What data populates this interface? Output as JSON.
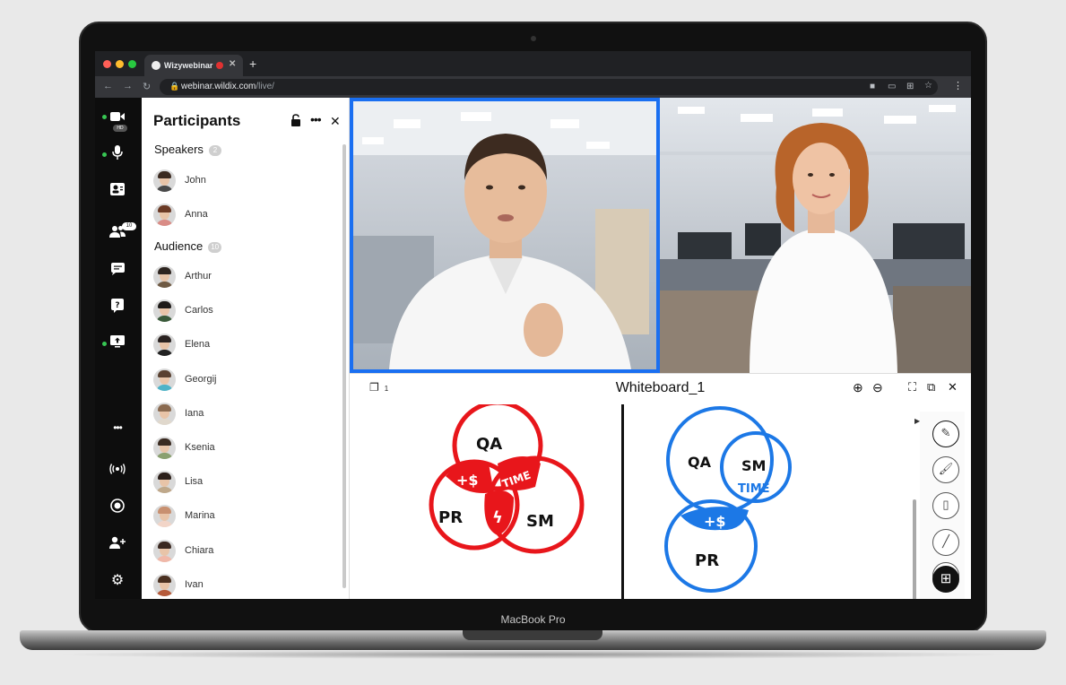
{
  "device": {
    "brand_label": "MacBook Pro"
  },
  "browser": {
    "tab_title": "Wizywebinar",
    "new_tab_symbol": "+",
    "url_host": "webinar.wildix.com",
    "url_path": "/live/"
  },
  "sidebar": {
    "hd_badge": "HD",
    "participants_count_badge": "10",
    "more_symbol": "•••"
  },
  "participants_panel": {
    "title": "Participants",
    "speakers": {
      "label": "Speakers",
      "count": "2",
      "items": [
        {
          "name": "John"
        },
        {
          "name": "Anna"
        }
      ]
    },
    "audience": {
      "label": "Audience",
      "count": "10",
      "items": [
        {
          "name": "Arthur"
        },
        {
          "name": "Carlos"
        },
        {
          "name": "Elena"
        },
        {
          "name": "Georgij"
        },
        {
          "name": "Iana"
        },
        {
          "name": "Ksenia"
        },
        {
          "name": "Lisa"
        },
        {
          "name": "Marina"
        },
        {
          "name": "Chiara"
        },
        {
          "name": "Ivan"
        }
      ]
    }
  },
  "whiteboard": {
    "title": "Whiteboard_1",
    "page_number": "1",
    "left_diagram": {
      "color": "#e8161b",
      "labels": [
        "QA",
        "PR",
        "SM",
        "+$",
        "TIME",
        "ϟ"
      ]
    },
    "right_diagram": {
      "color": "#1c78e6",
      "labels": [
        "QA",
        "SM",
        "TIME",
        "+$",
        "PR"
      ]
    }
  },
  "colors": {
    "active_speaker_border": "#1a6ff1",
    "status_green": "#37c653",
    "recording_red": "#e03131"
  }
}
